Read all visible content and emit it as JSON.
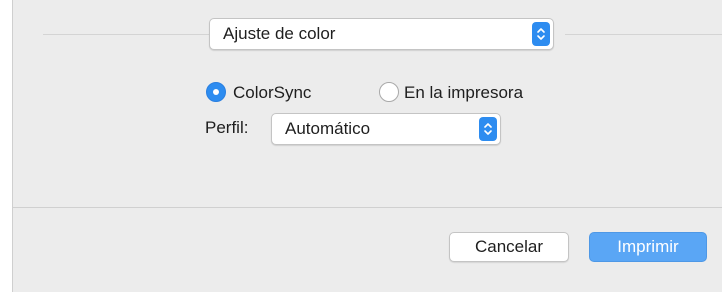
{
  "panel_select": {
    "value": "Ajuste de color"
  },
  "color_mode": {
    "options": [
      {
        "label": "ColorSync",
        "selected": true
      },
      {
        "label": "En la impresora",
        "selected": false
      }
    ]
  },
  "profile": {
    "label": "Perfil:",
    "value": "Automático"
  },
  "buttons": {
    "cancel": "Cancelar",
    "print": "Imprimir"
  },
  "colors": {
    "accent": "#2d8cf0",
    "default_button": "#5aa6f5",
    "background": "#ececec"
  },
  "icons": {
    "popup_stepper": "chevron-up-down-icon"
  }
}
